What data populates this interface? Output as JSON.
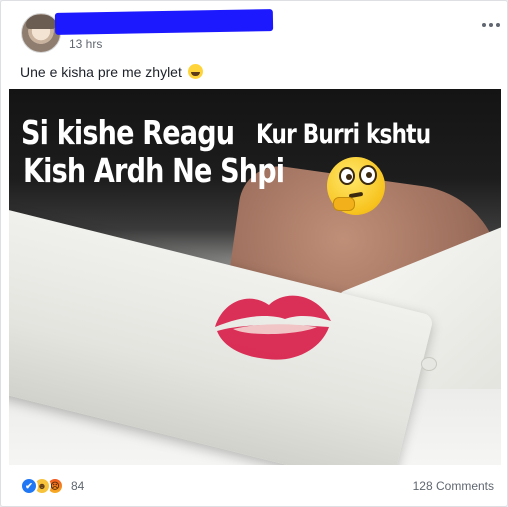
{
  "post": {
    "timestamp": "13 hrs",
    "text": "Une e kisha pre me zhylet",
    "text_emoji": "grinning-sweat-emoji",
    "more_icon": "more-horizontal-icon"
  },
  "photo": {
    "meme_line1": "Si kishe Reagu",
    "meme_line1b": "Kur Burri kshtu",
    "meme_line2": "Kish Ardh  Ne Shpi",
    "emoji": "thinking-face-emoji"
  },
  "footer": {
    "reactions": [
      "like",
      "haha",
      "angry"
    ],
    "reaction_count": "84",
    "comments": "128 Comments"
  },
  "colors": {
    "redaction": "#1d19ff",
    "like": "#2078f4",
    "haha": "#f7c33b",
    "angry": "#f2561e",
    "lipstick": "#d81e4a"
  }
}
